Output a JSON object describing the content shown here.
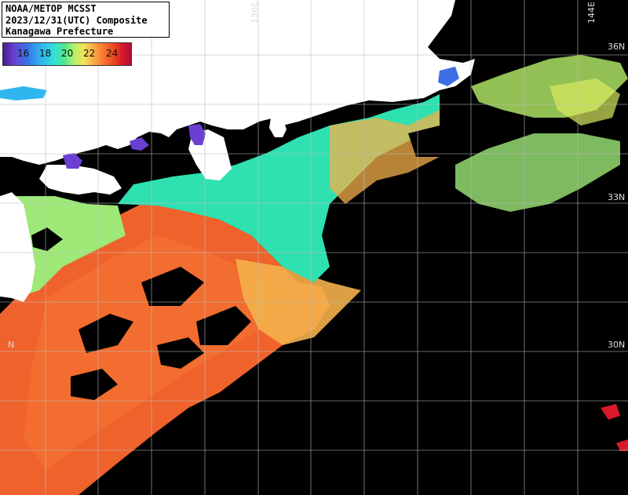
{
  "title": {
    "line1": "NOAA/METOP MCSST",
    "line2": "2023/12/31(UTC) Composite",
    "line3": "Kanagawa Prefecture"
  },
  "colorbar": {
    "labels": [
      "16",
      "18",
      "20",
      "22",
      "24"
    ]
  },
  "grid_labels": {
    "lon_136": "136E",
    "lon_144": "144E",
    "lat_36": "36N",
    "lat_33": "33N",
    "lat_30": "30N",
    "lat_27": "N"
  },
  "colors": {
    "land": "#ffffff",
    "missing": "#000000",
    "grid": "#bdbdbd",
    "warm": "#f0622c",
    "mid": "#f4b04a",
    "cool": "#32e4b8",
    "cold": "#2fa8ee"
  }
}
